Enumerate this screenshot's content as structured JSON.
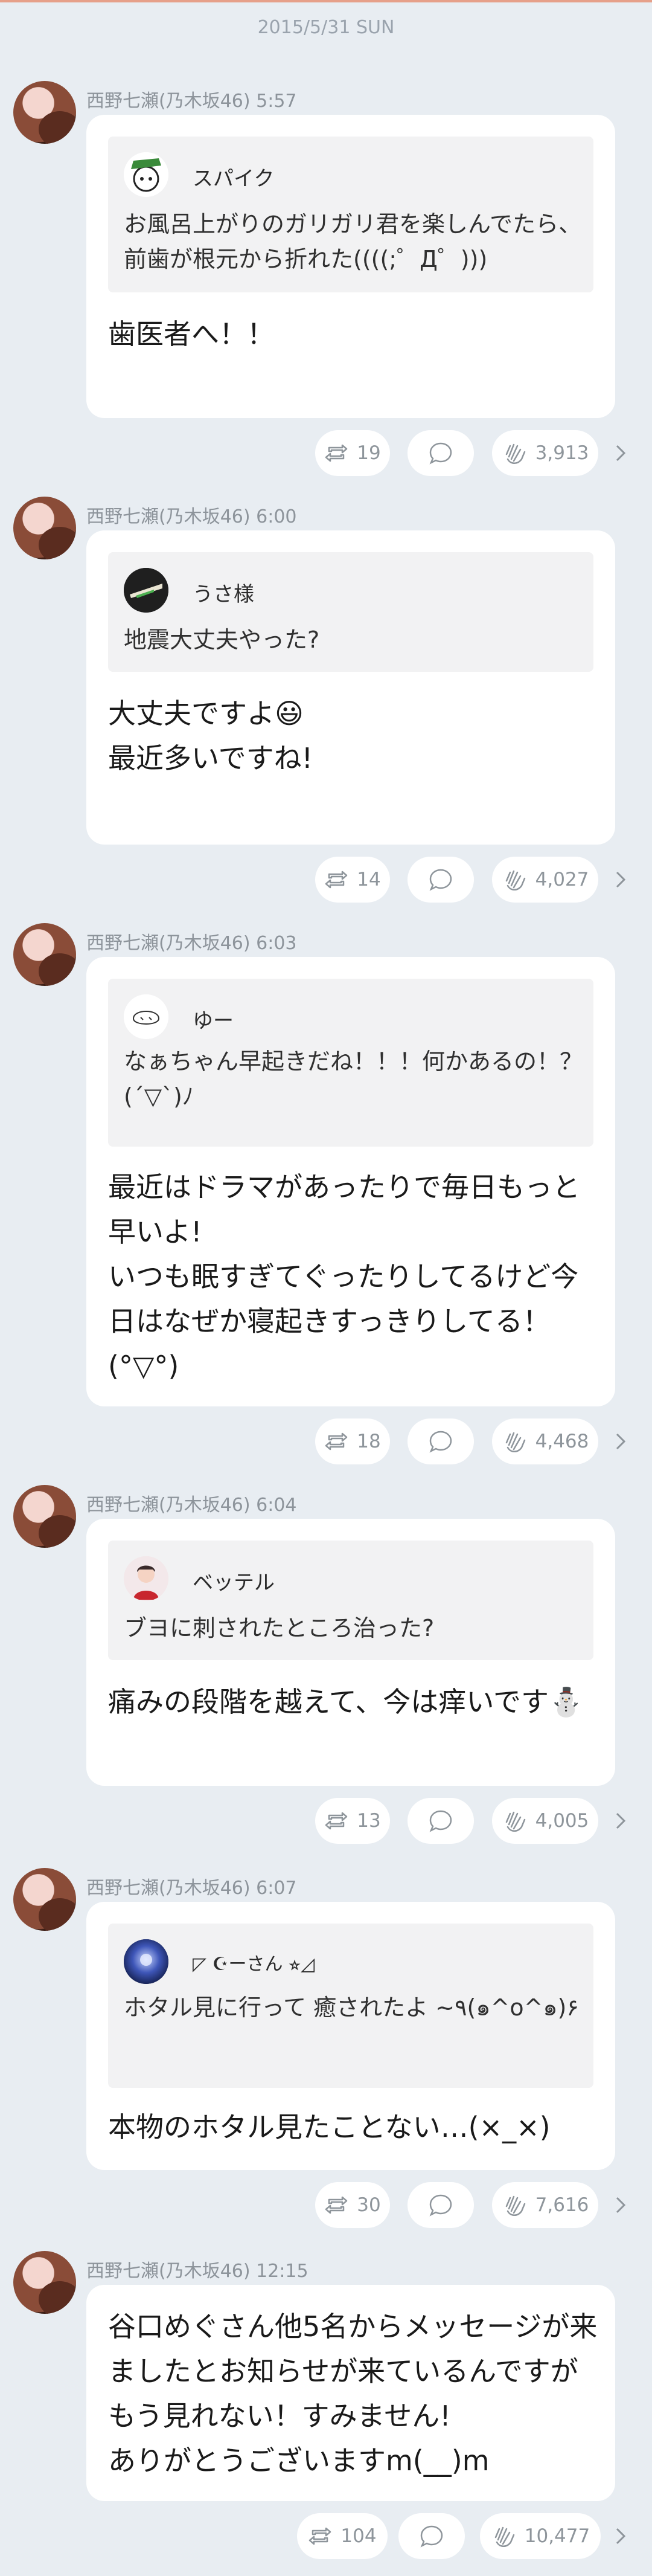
{
  "header": {
    "date": "2015/5/31 SUN"
  },
  "posts": [
    {
      "author": "西野七瀬(乃木坂46)",
      "time": "5:57",
      "quote_name": "スパイク",
      "quote_text": "お風呂上がりのガリガリ君を楽しんでたら、前歯が根元から折れた((((;゜Д゜)))",
      "reply": "歯医者へ！！",
      "retweets": "19",
      "likes": "3,913"
    },
    {
      "author": "西野七瀬(乃木坂46)",
      "time": "6:00",
      "quote_name": "うさ様",
      "quote_text": "地震大丈夫やった?",
      "reply": "大丈夫ですよ😃\n最近多いですね!",
      "retweets": "14",
      "likes": "4,027"
    },
    {
      "author": "西野七瀬(乃木坂46)",
      "time": "6:03",
      "quote_name": "ゆー",
      "quote_text": "なぁちゃん早起きだね！！！何かあるの！？(´▽`)ﾉ",
      "reply": "最近はドラマがあったりで毎日もっと早いよ!\nいつも眠すぎてぐったりしてるけど今日はなぜか寝起きすっきりしてる！(°▽°)",
      "retweets": "18",
      "likes": "4,468"
    },
    {
      "author": "西野七瀬(乃木坂46)",
      "time": "6:04",
      "quote_name": "ベッテル",
      "quote_text": "ブヨに刺されたところ治った?",
      "reply": "痛みの段階を越えて、今は痒いです⛄",
      "retweets": "13",
      "likes": "4,005"
    },
    {
      "author": "西野七瀬(乃木坂46)",
      "time": "6:07",
      "quote_name": "◸ ☪︎ーさん ⭐︎◿",
      "quote_text": "ホタル見に行って 癒されたよ ~٩(๑^o^๑)۶",
      "reply": "本物のホタル見たことない…(×_×)",
      "retweets": "30",
      "likes": "7,616"
    },
    {
      "author": "西野七瀬(乃木坂46)",
      "time": "12:15",
      "reply": "谷口めぐさん他5名からメッセージが来ましたとお知らせが来ているんですがもう見れない！すみません!\nありがとうございますm(__)m",
      "retweets": "104",
      "likes": "10,477"
    }
  ],
  "icons": {
    "retweet": "retweet-icon",
    "comment": "comment-bubble-icon",
    "like": "clap-hands-icon",
    "more": "chevron-right-icon"
  },
  "colors": {
    "background": "#e8edf2",
    "card": "#ffffff",
    "quote_bg": "#f2f2f3",
    "meta": "#8d949b"
  }
}
